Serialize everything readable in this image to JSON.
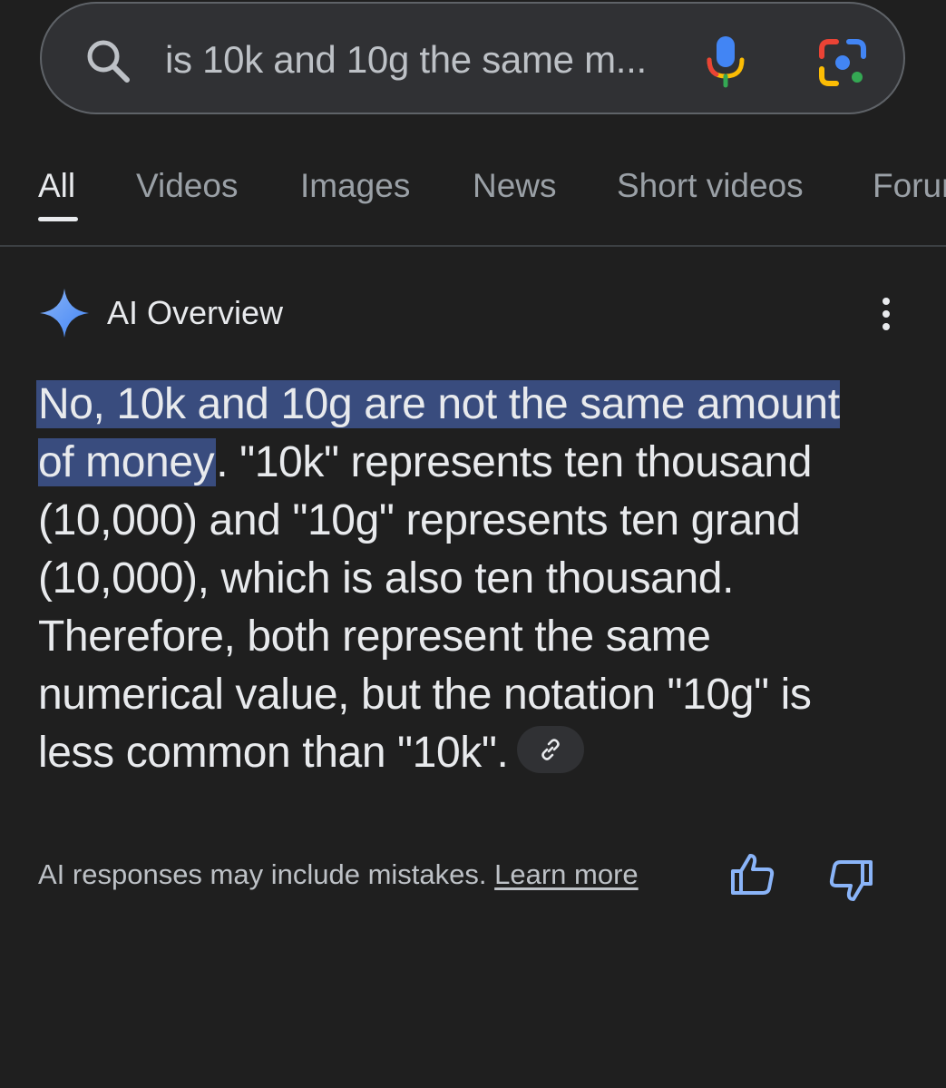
{
  "search": {
    "query": "is 10k and 10g the same m..."
  },
  "tabs": [
    {
      "label": "All",
      "active": true
    },
    {
      "label": "Videos",
      "active": false
    },
    {
      "label": "Images",
      "active": false
    },
    {
      "label": "News",
      "active": false
    },
    {
      "label": "Short videos",
      "active": false
    },
    {
      "label": "Forums",
      "active": false
    }
  ],
  "ai_overview": {
    "title": "AI Overview",
    "highlighted_text": "No, 10k and 10g are not the same amount of money",
    "body_text": ". \"10k\" represents ten thousand (10,000) and \"10g\" represents ten grand (10,000), which is also ten thousand. Therefore, both represent the same numerical value, but the notation \"10g\" is less common than \"10k\".",
    "link_icon": "link-icon"
  },
  "footer": {
    "disclaimer": "AI responses may include mistakes.",
    "learn_more": "Learn more"
  },
  "colors": {
    "background": "#1f1f1f",
    "search_bg": "#303134",
    "highlight": "#394c7e",
    "accent_blue": "#8ab4f8"
  }
}
